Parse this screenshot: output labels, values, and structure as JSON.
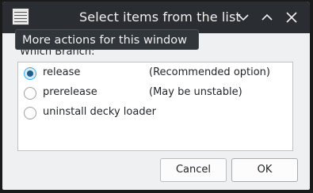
{
  "window": {
    "title": "Select items from the list",
    "menu_icon": "menu-icon",
    "controls": {
      "minimize_icon": "chevron-down-icon",
      "maximize_icon": "chevron-up-icon",
      "close_icon": "close-icon"
    }
  },
  "tooltip": {
    "text": "More actions for this window"
  },
  "prompt": {
    "label": "Which Branch:"
  },
  "options": [
    {
      "name": "release",
      "description": "(Recommended option)",
      "selected": true
    },
    {
      "name": "prerelease",
      "description": "(May be unstable)",
      "selected": false
    },
    {
      "name": "uninstall decky loader",
      "description": "",
      "selected": false
    }
  ],
  "buttons": {
    "cancel_label": "Cancel",
    "ok_label": "OK"
  },
  "colors": {
    "titlebar": "#2a2e32",
    "accent": "#3daee9",
    "dialog_bg": "#eff0f1"
  }
}
